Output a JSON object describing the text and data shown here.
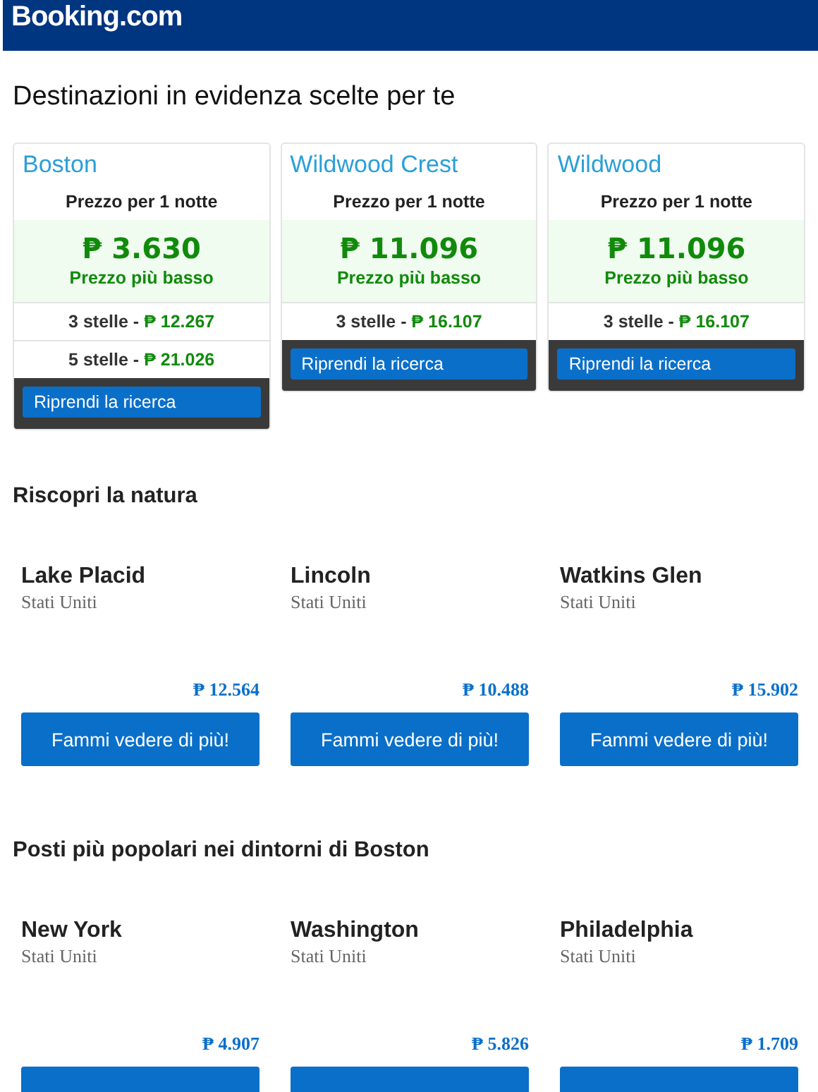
{
  "header": {
    "logo": "Booking.com"
  },
  "featured": {
    "title": "Destinazioni in evidenza scelte per te",
    "cards": [
      {
        "city": "Boston",
        "price_label": "Prezzo per 1 notte",
        "price": "₱ 3.630",
        "price_note": "Prezzo più basso",
        "star_rows": [
          {
            "label": "3 stelle -",
            "price": "₱ 12.267"
          },
          {
            "label": "5 stelle -",
            "price": "₱ 21.026"
          }
        ],
        "button": "Riprendi la ricerca"
      },
      {
        "city": "Wildwood Crest",
        "price_label": "Prezzo per 1 notte",
        "price": "₱ 11.096",
        "price_note": "Prezzo più basso",
        "star_rows": [
          {
            "label": "3 stelle -",
            "price": "₱ 16.107"
          }
        ],
        "button": "Riprendi la ricerca"
      },
      {
        "city": "Wildwood",
        "price_label": "Prezzo per 1 notte",
        "price": "₱ 11.096",
        "price_note": "Prezzo più basso",
        "star_rows": [
          {
            "label": "3 stelle -",
            "price": "₱ 16.107"
          }
        ],
        "button": "Riprendi la ricerca"
      }
    ]
  },
  "sections": [
    {
      "title": "Riscopri la natura",
      "items": [
        {
          "name": "Lake Placid",
          "country": "Stati Uniti",
          "price": "₱ 12.564",
          "button": "Fammi vedere di più!"
        },
        {
          "name": "Lincoln",
          "country": "Stati Uniti",
          "price": "₱ 10.488",
          "button": "Fammi vedere di più!"
        },
        {
          "name": "Watkins Glen",
          "country": "Stati Uniti",
          "price": "₱ 15.902",
          "button": "Fammi vedere di più!"
        }
      ]
    },
    {
      "title": "Posti più popolari nei dintorni di Boston",
      "items": [
        {
          "name": "New York",
          "country": "Stati Uniti",
          "price": "₱ 4.907"
        },
        {
          "name": "Washington",
          "country": "Stati Uniti",
          "price": "₱ 5.826"
        },
        {
          "name": "Philadelphia",
          "country": "Stati Uniti",
          "price": "₱ 1.709"
        }
      ]
    }
  ]
}
